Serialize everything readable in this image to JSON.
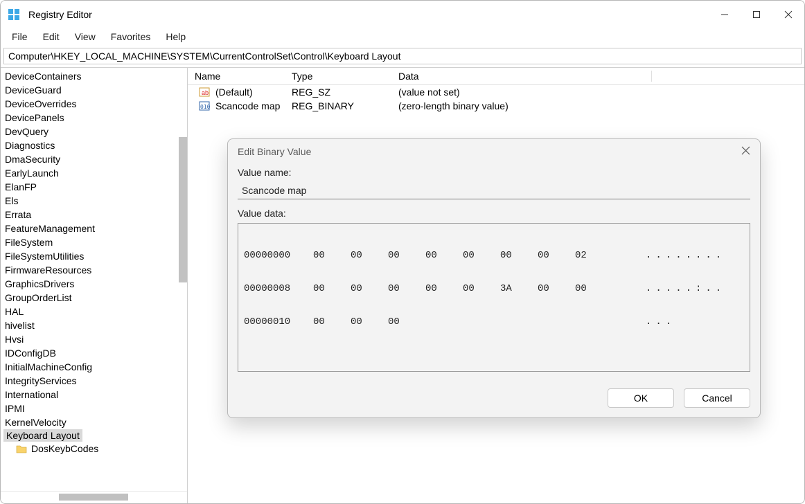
{
  "window": {
    "title": "Registry Editor"
  },
  "menubar": [
    "File",
    "Edit",
    "View",
    "Favorites",
    "Help"
  ],
  "address": "Computer\\HKEY_LOCAL_MACHINE\\SYSTEM\\CurrentControlSet\\Control\\Keyboard Layout",
  "tree": {
    "items": [
      "DeviceContainers",
      "DeviceGuard",
      "DeviceOverrides",
      "DevicePanels",
      "DevQuery",
      "Diagnostics",
      "DmaSecurity",
      "EarlyLaunch",
      "ElanFP",
      "Els",
      "Errata",
      "FeatureManagement",
      "FileSystem",
      "FileSystemUtilities",
      "FirmwareResources",
      "GraphicsDrivers",
      "GroupOrderList",
      "HAL",
      "hivelist",
      "Hvsi",
      "IDConfigDB",
      "InitialMachineConfig",
      "IntegrityServices",
      "International",
      "IPMI",
      "KernelVelocity"
    ],
    "selected": "Keyboard Layout",
    "child": "DosKeybCodes"
  },
  "list": {
    "columns": {
      "name": "Name",
      "type": "Type",
      "data": "Data"
    },
    "rows": [
      {
        "icon": "sz",
        "name": "(Default)",
        "type": "REG_SZ",
        "data": "(value not set)"
      },
      {
        "icon": "bin",
        "name": "Scancode map",
        "type": "REG_BINARY",
        "data": "(zero-length binary value)"
      }
    ]
  },
  "dialog": {
    "title": "Edit Binary Value",
    "value_name_label": "Value name:",
    "value_name": "Scancode map",
    "value_data_label": "Value data:",
    "hex": [
      {
        "offset": "00000000",
        "bytes": [
          "00",
          "00",
          "00",
          "00",
          "00",
          "00",
          "00",
          "02"
        ],
        "ascii": "........"
      },
      {
        "offset": "00000008",
        "bytes": [
          "00",
          "00",
          "00",
          "00",
          "00",
          "3A",
          "00",
          "00"
        ],
        "ascii": ".....:.."
      },
      {
        "offset": "00000010",
        "bytes": [
          "00",
          "00",
          "00"
        ],
        "ascii": "..."
      }
    ],
    "ok": "OK",
    "cancel": "Cancel"
  }
}
